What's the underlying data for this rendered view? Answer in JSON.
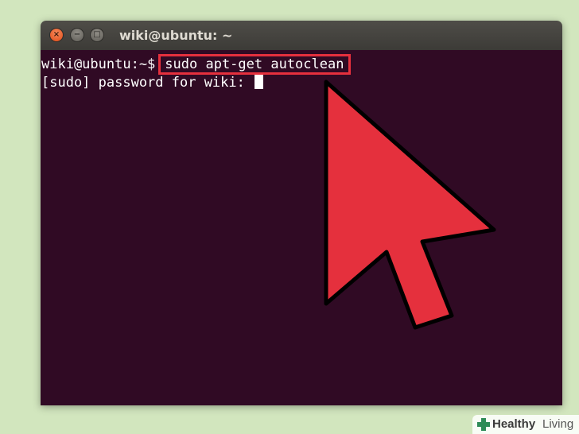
{
  "window": {
    "title": "wiki@ubuntu: ~",
    "buttons": {
      "close": "×",
      "minimize": "−",
      "maximize": "□"
    }
  },
  "terminal": {
    "prompt": "wiki@ubuntu:~$",
    "command": "sudo apt-get autoclean",
    "password_prompt": "[sudo] password for wiki: "
  },
  "colors": {
    "terminal_background": "#300a24",
    "highlight": "#e5303d",
    "page_background": "#d2e6be"
  },
  "watermark": {
    "brand_part1": "Healthy",
    "brand_part2": "Living"
  }
}
